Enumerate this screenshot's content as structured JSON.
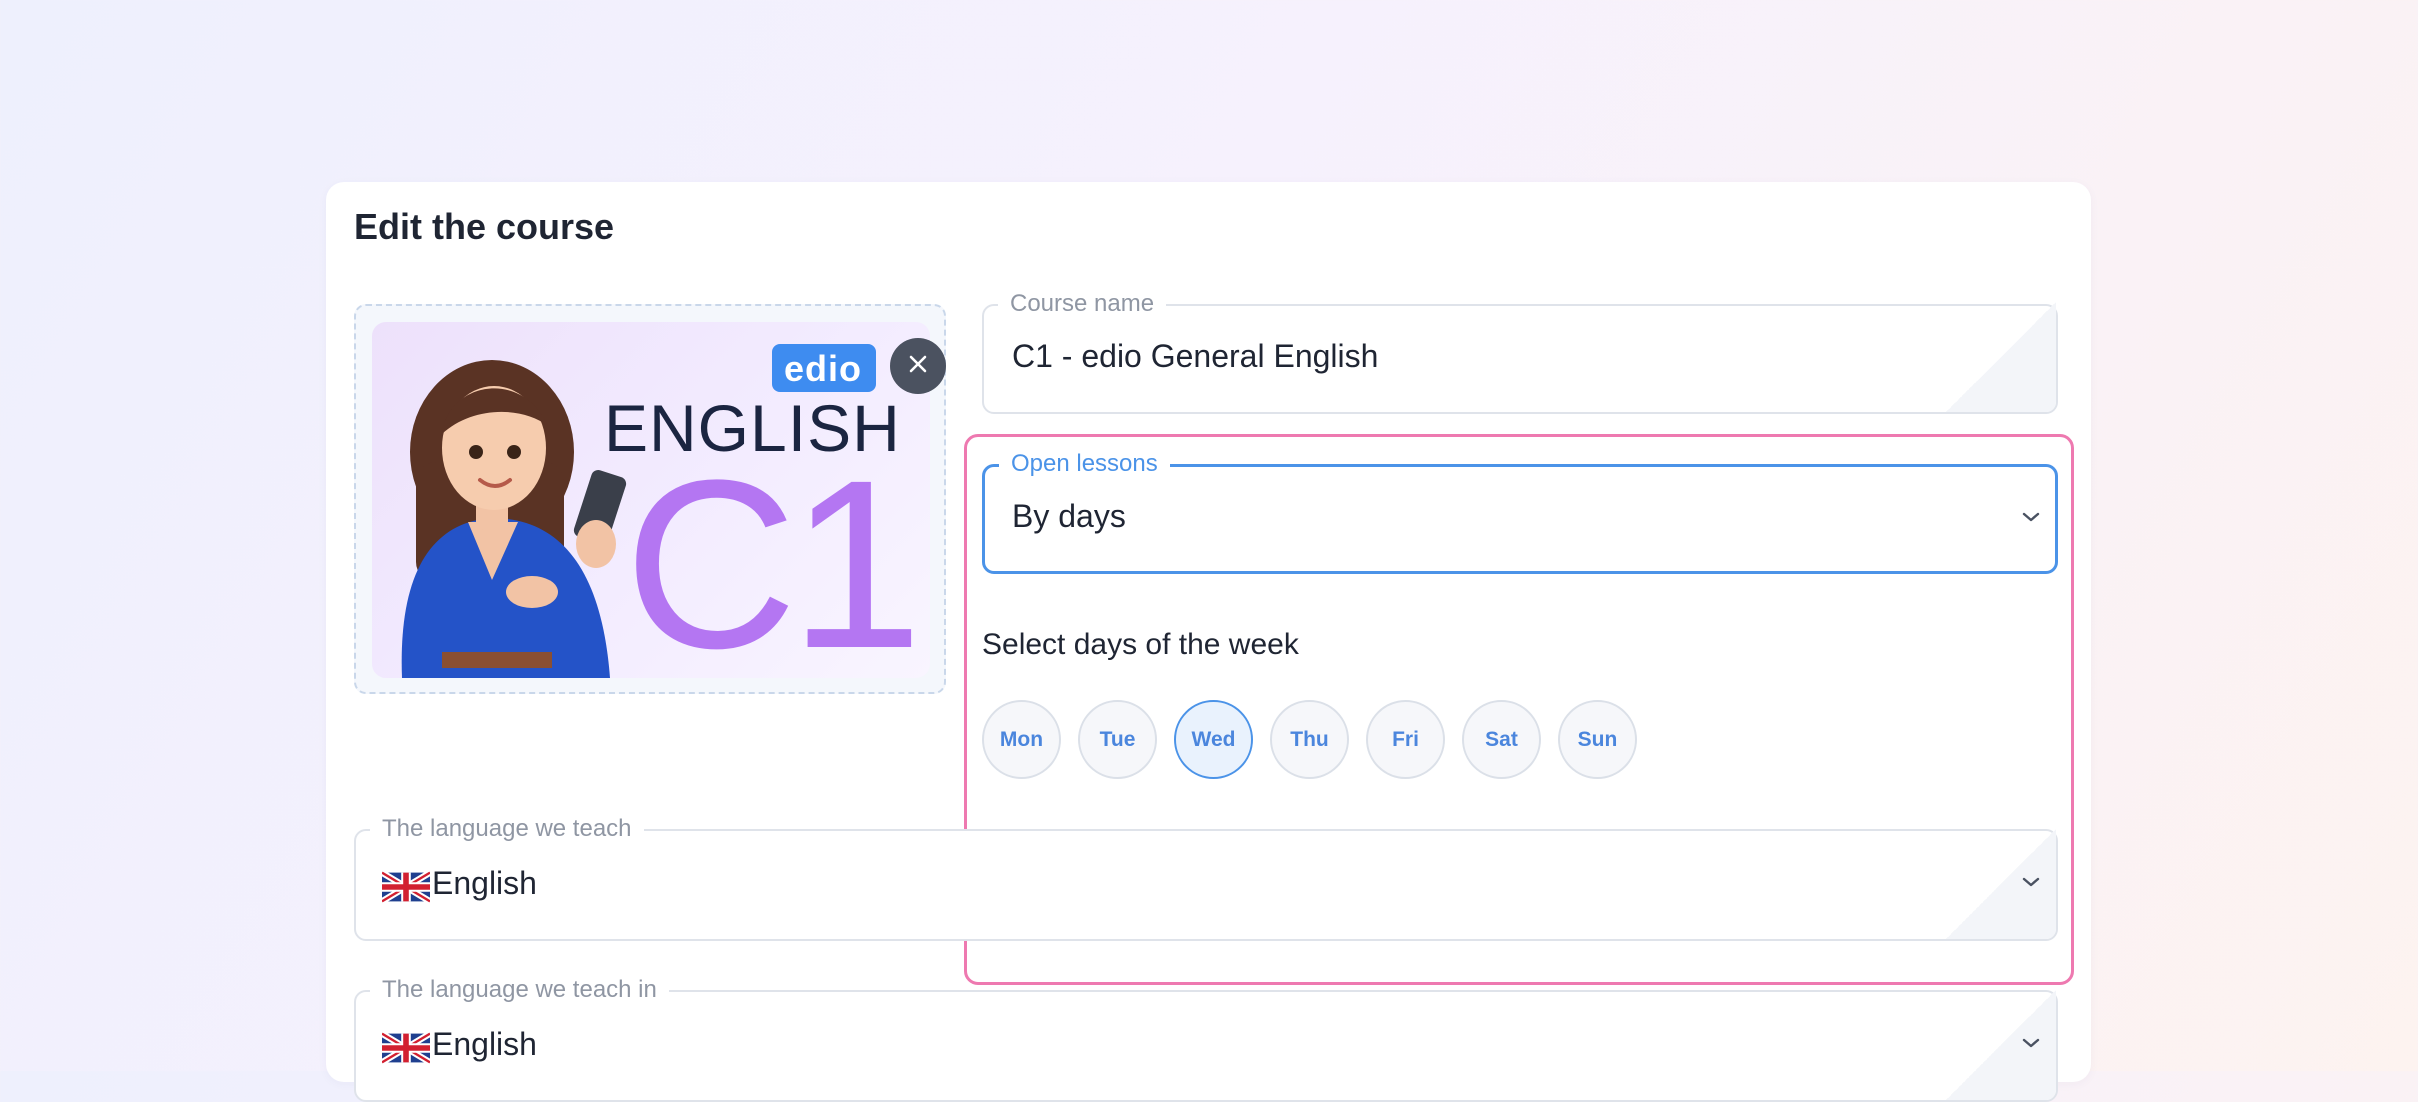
{
  "card": {
    "title": "Edit the course"
  },
  "cover": {
    "brand": "edio",
    "word": "ENGLISH",
    "level": "C1",
    "remove_icon": "close-icon"
  },
  "course_name": {
    "label": "Course name",
    "value": "C1 - edio General English"
  },
  "open_lessons": {
    "label": "Open lessons",
    "value": "By days",
    "icon": "chevron-down-icon"
  },
  "days_section": {
    "label": "Select days of the week",
    "days": [
      {
        "label": "Mon",
        "selected": false
      },
      {
        "label": "Tue",
        "selected": false
      },
      {
        "label": "Wed",
        "selected": true
      },
      {
        "label": "Thu",
        "selected": false
      },
      {
        "label": "Fri",
        "selected": false
      },
      {
        "label": "Sat",
        "selected": false
      },
      {
        "label": "Sun",
        "selected": false
      }
    ]
  },
  "teach_language": {
    "label": "The language we teach",
    "value": "English",
    "flag": "uk-flag-icon",
    "icon": "chevron-down-icon"
  },
  "teach_in_language": {
    "label": "The language we teach in",
    "value": "English",
    "flag": "uk-flag-icon",
    "icon": "chevron-down-icon"
  },
  "colors": {
    "accent": "#4b93e8",
    "highlight": "#ee79b0",
    "cover_level": "#b476f2",
    "brand": "#3e8cf0"
  }
}
